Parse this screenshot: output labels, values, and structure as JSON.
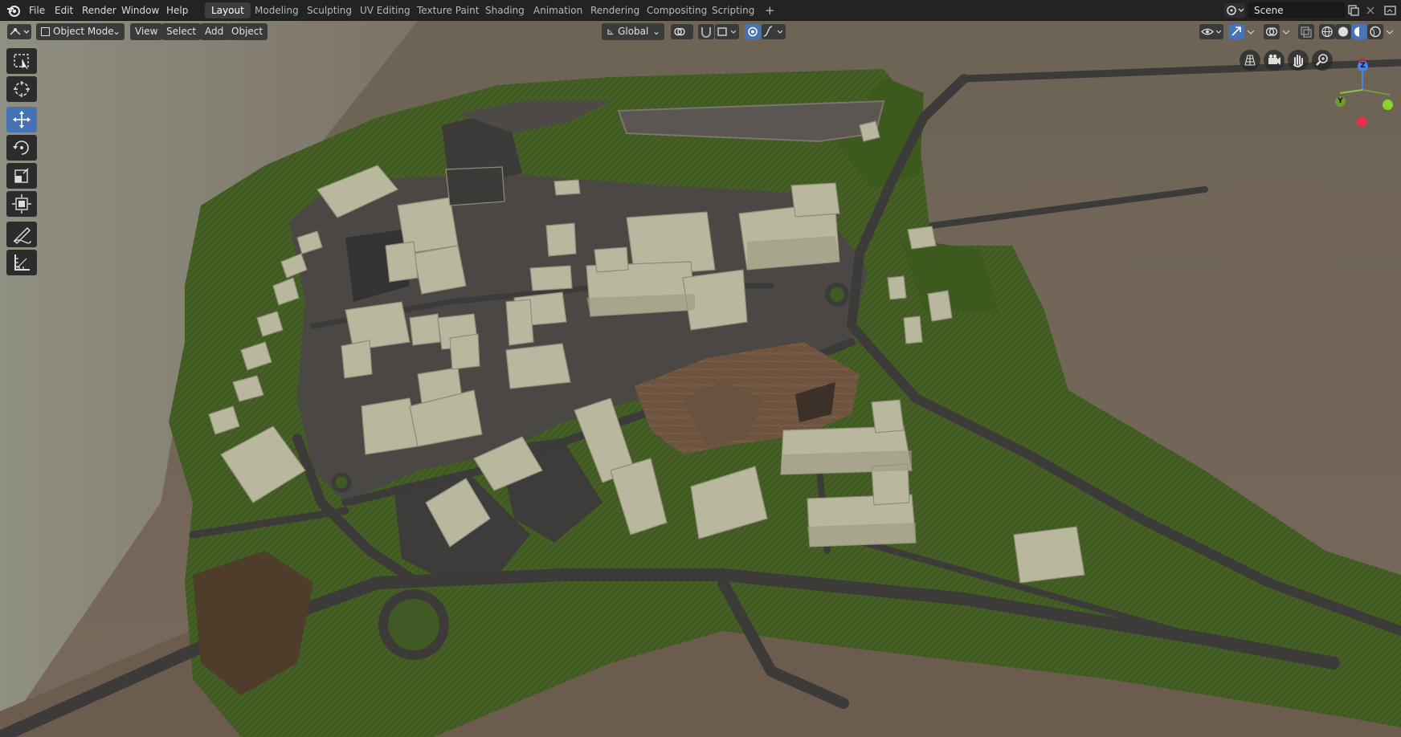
{
  "menubar": {
    "items": [
      "File",
      "Edit",
      "Render",
      "Window",
      "Help"
    ],
    "workspaces": [
      "Layout",
      "Modeling",
      "Sculpting",
      "UV Editing",
      "Texture Paint",
      "Shading",
      "Animation",
      "Rendering",
      "Compositing",
      "Scripting"
    ],
    "active_workspace": "Layout",
    "add_workspace": "+",
    "scene_name": "Scene"
  },
  "viewport_header": {
    "mode": "Object Mode",
    "menus": [
      "View",
      "Select",
      "Add",
      "Object"
    ],
    "transform_orientation": "Global"
  },
  "toolbar": {
    "tools": [
      "select-box",
      "cursor",
      "move",
      "rotate",
      "scale",
      "transform",
      "annotate",
      "measure"
    ],
    "active_tool": "move"
  },
  "gizmo": {
    "axes": [
      "Z",
      "Y"
    ]
  },
  "colors": {
    "ui_bg": "#232323",
    "accent": "#4772b3",
    "terrain": "#6b5a4a",
    "grass": "#3f5a22",
    "road": "#3f3d3b",
    "building": "#b9b79e"
  }
}
